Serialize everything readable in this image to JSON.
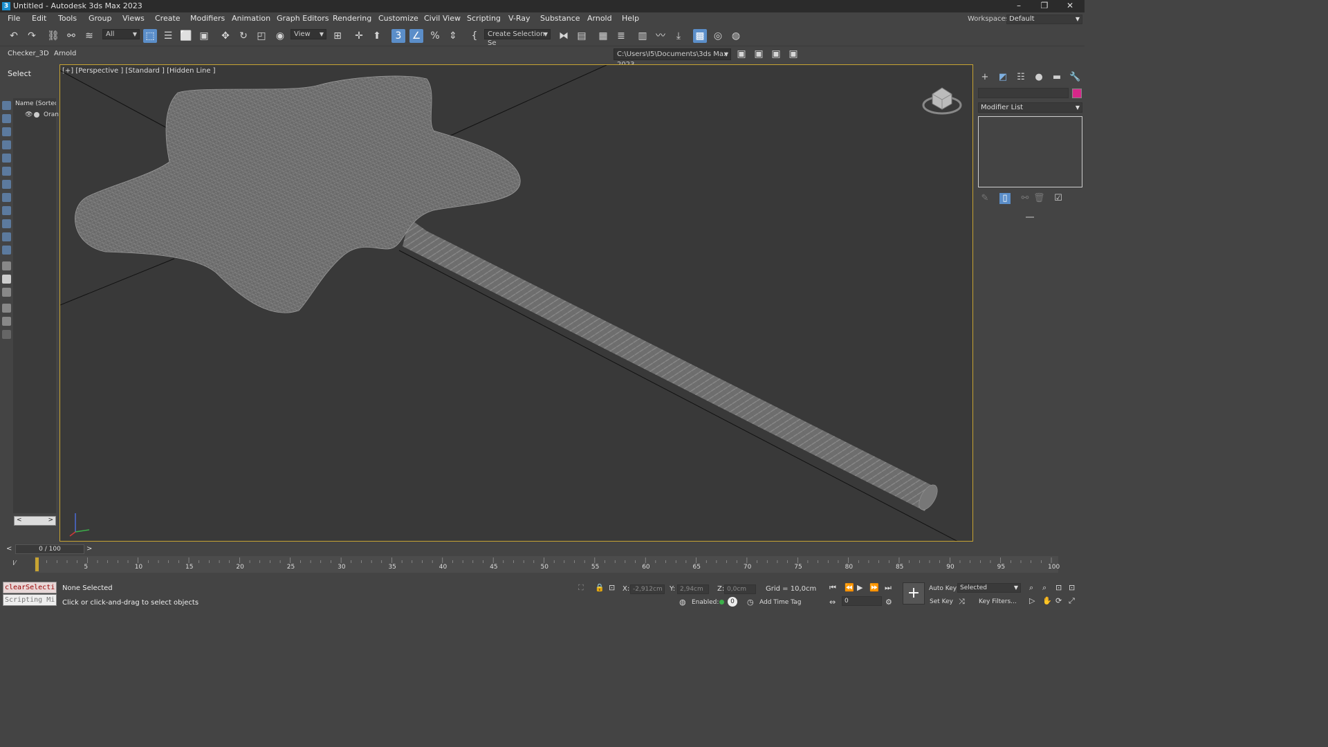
{
  "window": {
    "title": "Untitled - Autodesk 3ds Max 2023",
    "app_icon": "3",
    "controls": [
      "–",
      "❐",
      "✕"
    ]
  },
  "menu": [
    "File",
    "Edit",
    "Tools",
    "Group",
    "Views",
    "Create",
    "Modifiers",
    "Animation",
    "Graph Editors",
    "Rendering",
    "Customize",
    "Civil View",
    "Scripting",
    "V-Ray",
    "Substance",
    "Arnold",
    "Help"
  ],
  "workspace": {
    "label": "Workspaces:",
    "value": "Default"
  },
  "toolbar": {
    "filter_value": "All",
    "ref_coord_value": "View",
    "selection_set_value": "Create Selection Se",
    "snap_label": "3",
    "path_value": "C:\\Users\\I5\\Documents\\3ds Max 2023"
  },
  "ribbon_tabs": [
    "Checker_3D",
    "Arnold"
  ],
  "scene_explorer": {
    "header": "Select",
    "column": "Name (Sorted A",
    "object": "Oran"
  },
  "viewport": {
    "label": "[+] [Perspective ] [Standard ] [Hidden Line ]"
  },
  "command_panel": {
    "modifier_list": "Modifier List"
  },
  "timeline": {
    "slider": "0 / 100",
    "ticks": [
      5,
      10,
      15,
      20,
      25,
      30,
      35,
      40,
      45,
      50,
      55,
      60,
      65,
      70,
      75,
      80,
      85,
      90,
      95,
      100
    ]
  },
  "status": {
    "maxscript_line1": "clearSelecti",
    "maxscript_line2": "Scripting Mi",
    "selection": "None Selected",
    "prompt": "Click or click-and-drag to select objects",
    "x_label": "X:",
    "x_value": "-2,912cm",
    "y_label": "Y:",
    "y_value": "2,94cm",
    "z_label": "Z:",
    "z_value": "0,0cm",
    "grid": "Grid = 10,0cm",
    "enabled": "Enabled:",
    "enabled_value": "0",
    "add_time_tag": "Add Time Tag",
    "frame_value": "0",
    "auto_key": "Auto Key",
    "set_key": "Set Key",
    "selected_value": "Selected",
    "key_filters": "Key Filters..."
  }
}
